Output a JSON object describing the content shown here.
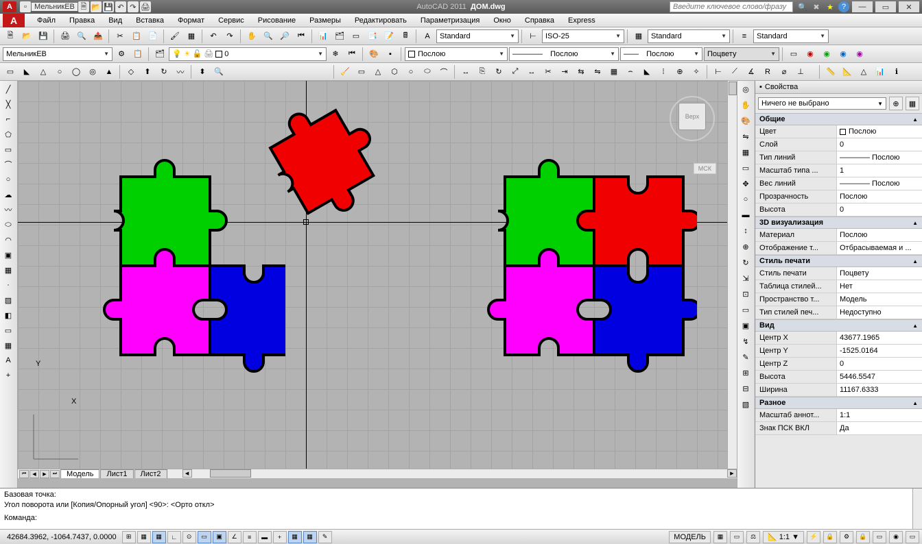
{
  "title": {
    "prefix": "МельникЕВ",
    "app": "AutoCAD 2011",
    "file": "ДОМ.dwg"
  },
  "search_placeholder": "Введите ключевое слово/фразу",
  "menu": [
    "Файл",
    "Правка",
    "Вид",
    "Вставка",
    "Формат",
    "Сервис",
    "Рисование",
    "Размеры",
    "Редактировать",
    "Параметризация",
    "Окно",
    "Справка",
    "Express"
  ],
  "toolbar1": {
    "text_style": "Standard",
    "dim_style": "ISO-25",
    "table_style": "Standard",
    "ml_style": "Standard"
  },
  "toolbar2": {
    "user": "МельникЕВ",
    "layer": "0",
    "color": "Послою",
    "linetype": "Послою",
    "lineweight": "Послою",
    "plotstyle": "Поцвету"
  },
  "viewcube": {
    "label": "Верх",
    "ucs": "МСК"
  },
  "tabs": {
    "model": "Модель",
    "layouts": [
      "Лист1",
      "Лист2"
    ]
  },
  "cmd": {
    "l1": "Базовая точка:",
    "l2": "Угол поворота или [Копия/Опорный угол] <90>:  <Орто откл>",
    "l3": "Команда:"
  },
  "status": {
    "coords": "42684.3962, -1064.7437, 0.0000",
    "model": "МОДЕЛЬ",
    "scale": "1:1"
  },
  "props": {
    "title": "Свойства",
    "selection": "Ничего не выбрано",
    "sections": {
      "general": {
        "title": "Общие",
        "rows": [
          {
            "label": "Цвет",
            "value": "Послою",
            "swatch": true
          },
          {
            "label": "Слой",
            "value": "0"
          },
          {
            "label": "Тип линий",
            "value": "———— Послою"
          },
          {
            "label": "Масштаб типа ...",
            "value": "1"
          },
          {
            "label": "Вес линий",
            "value": "———— Послою"
          },
          {
            "label": "Прозрачность",
            "value": "Послою"
          },
          {
            "label": "Высота",
            "value": "0"
          }
        ]
      },
      "viz3d": {
        "title": "3D визуализация",
        "rows": [
          {
            "label": "Материал",
            "value": "Послою"
          },
          {
            "label": "Отображение т...",
            "value": "Отбрасываемая и ..."
          }
        ]
      },
      "plot": {
        "title": "Стиль печати",
        "rows": [
          {
            "label": "Стиль печати",
            "value": "Поцвету"
          },
          {
            "label": "Таблица стилей...",
            "value": "Нет"
          },
          {
            "label": "Пространство т...",
            "value": "Модель"
          },
          {
            "label": "Тип стилей печ...",
            "value": "Недоступно"
          }
        ]
      },
      "view": {
        "title": "Вид",
        "rows": [
          {
            "label": "Центр X",
            "value": "43677.1965"
          },
          {
            "label": "Центр Y",
            "value": "-1525.0164"
          },
          {
            "label": "Центр Z",
            "value": "0"
          },
          {
            "label": "Высота",
            "value": "5446.5547"
          },
          {
            "label": "Ширина",
            "value": "11167.6333"
          }
        ]
      },
      "misc": {
        "title": "Разное",
        "rows": [
          {
            "label": "Масштаб аннот...",
            "value": "1:1"
          },
          {
            "label": "Знак ПСК ВКЛ",
            "value": "Да"
          }
        ]
      }
    }
  }
}
